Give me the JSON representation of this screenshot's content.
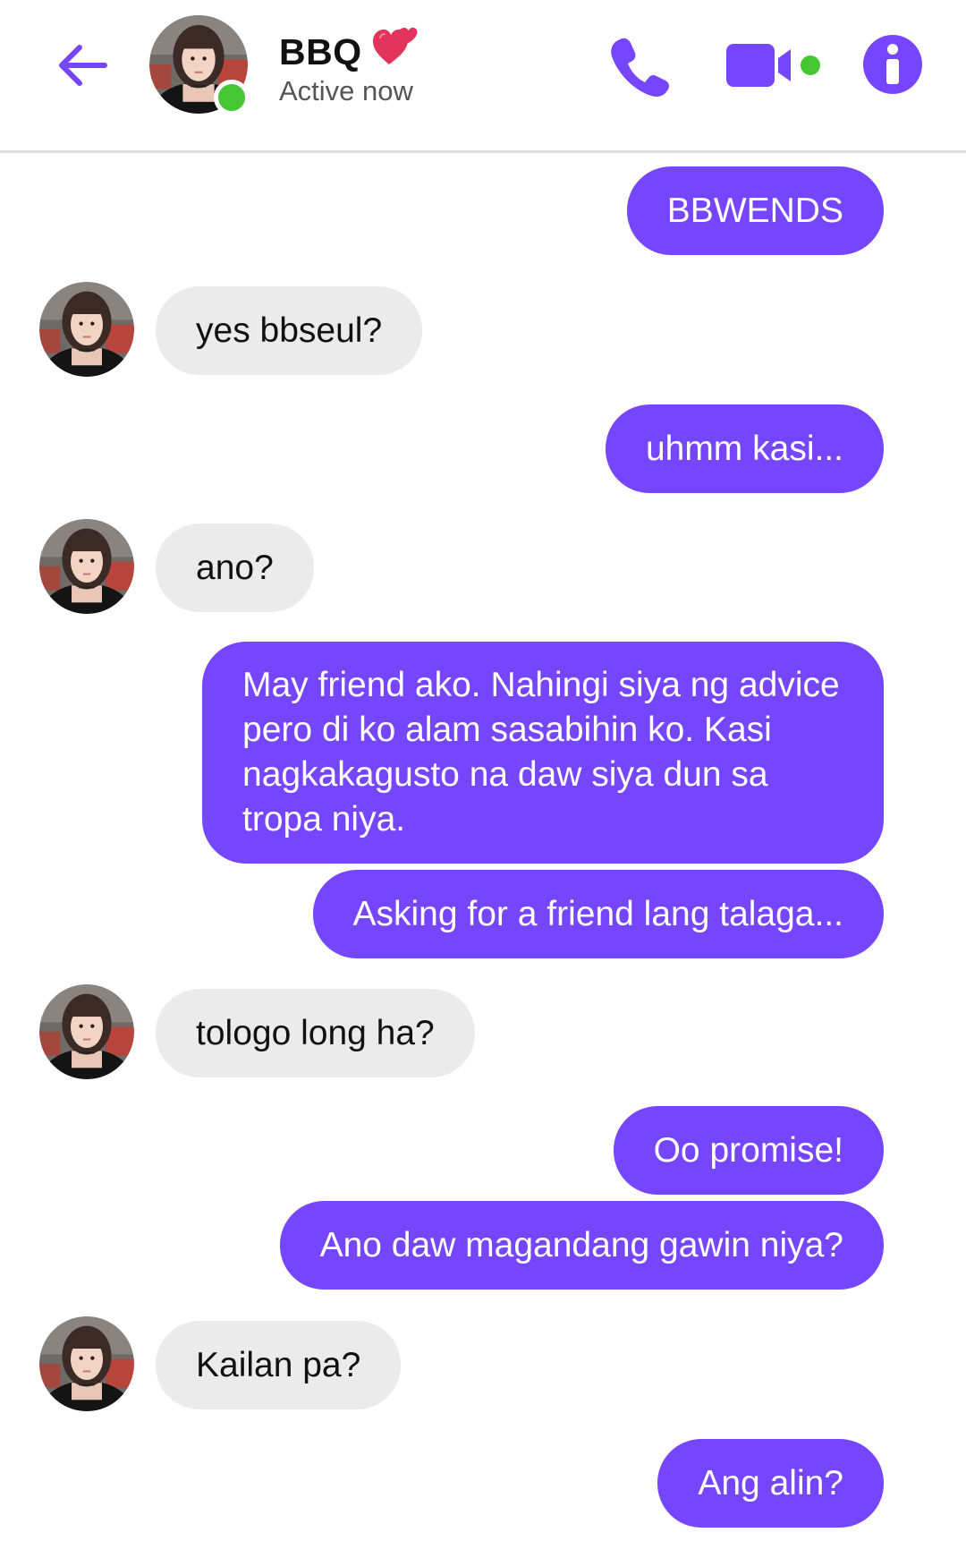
{
  "header": {
    "back_icon": "arrow-left-icon",
    "contact_name": "BBQ",
    "name_emoji": "two-hearts-icon",
    "status": "Active now",
    "actions": {
      "call_icon": "phone-icon",
      "video_icon": "video-camera-icon",
      "info_icon": "info-icon"
    }
  },
  "colors": {
    "accent": "#7646ff",
    "incoming_bubble": "#ebebeb",
    "online": "#45c733",
    "divider": "#dedede"
  },
  "messages": [
    {
      "direction": "out",
      "text": "BBWENDS"
    },
    {
      "direction": "in",
      "text": "yes bbseul?"
    },
    {
      "direction": "out",
      "text": "uhmm kasi..."
    },
    {
      "direction": "in",
      "text": "ano?"
    },
    {
      "direction": "out",
      "text": "May friend ako. Nahingi siya ng advice pero di ko alam sasabihin ko. Kasi nagkakagusto na daw siya dun sa tropa niya."
    },
    {
      "direction": "out",
      "text": "Asking for a friend lang talaga..."
    },
    {
      "direction": "in",
      "text": "tologo long ha?"
    },
    {
      "direction": "out",
      "text": "Oo promise!"
    },
    {
      "direction": "out",
      "text": "Ano daw magandang gawin niya?"
    },
    {
      "direction": "in",
      "text": "Kailan pa?"
    },
    {
      "direction": "out",
      "text": "Ang alin?"
    }
  ]
}
